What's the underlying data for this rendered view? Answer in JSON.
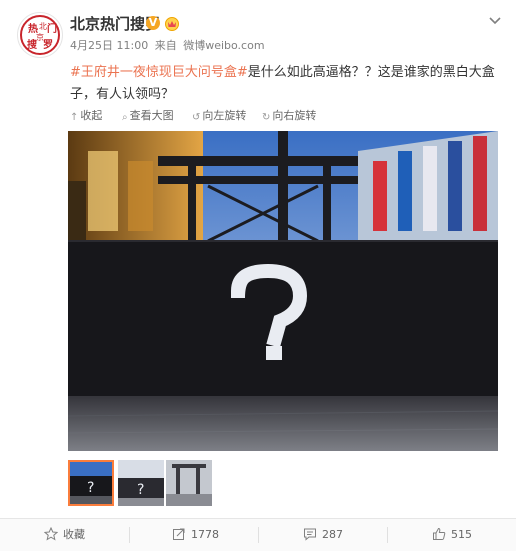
{
  "user": {
    "nickname": "北京热门搜罗",
    "avatar_text": [
      "热",
      "北",
      "门",
      "京",
      "搜",
      "罗"
    ],
    "verified_badge": "V",
    "verified_icon": "verified-v-icon",
    "member_icon": "member-crown-icon"
  },
  "post": {
    "time": "4月25日 11:00",
    "source_prefix": "来自",
    "source": "微博weibo.com",
    "hashtag": "#王府井一夜惊现巨大问号盒#",
    "text": "是什么如此高逼格？？这是谁家的黑白大盒子，有人认领吗？"
  },
  "image_toolbar": {
    "collapse": "收起",
    "view_large": "查看大图",
    "rotate_left": "向左旋转",
    "rotate_right": "向右旋转"
  },
  "footer": {
    "favorite": "收藏",
    "repost_count": "1778",
    "comment_count": "287",
    "like_count": "515"
  },
  "colors": {
    "accent": "#eb7350",
    "badge": "#f5a623",
    "thumb_border": "#fa7d3c"
  }
}
